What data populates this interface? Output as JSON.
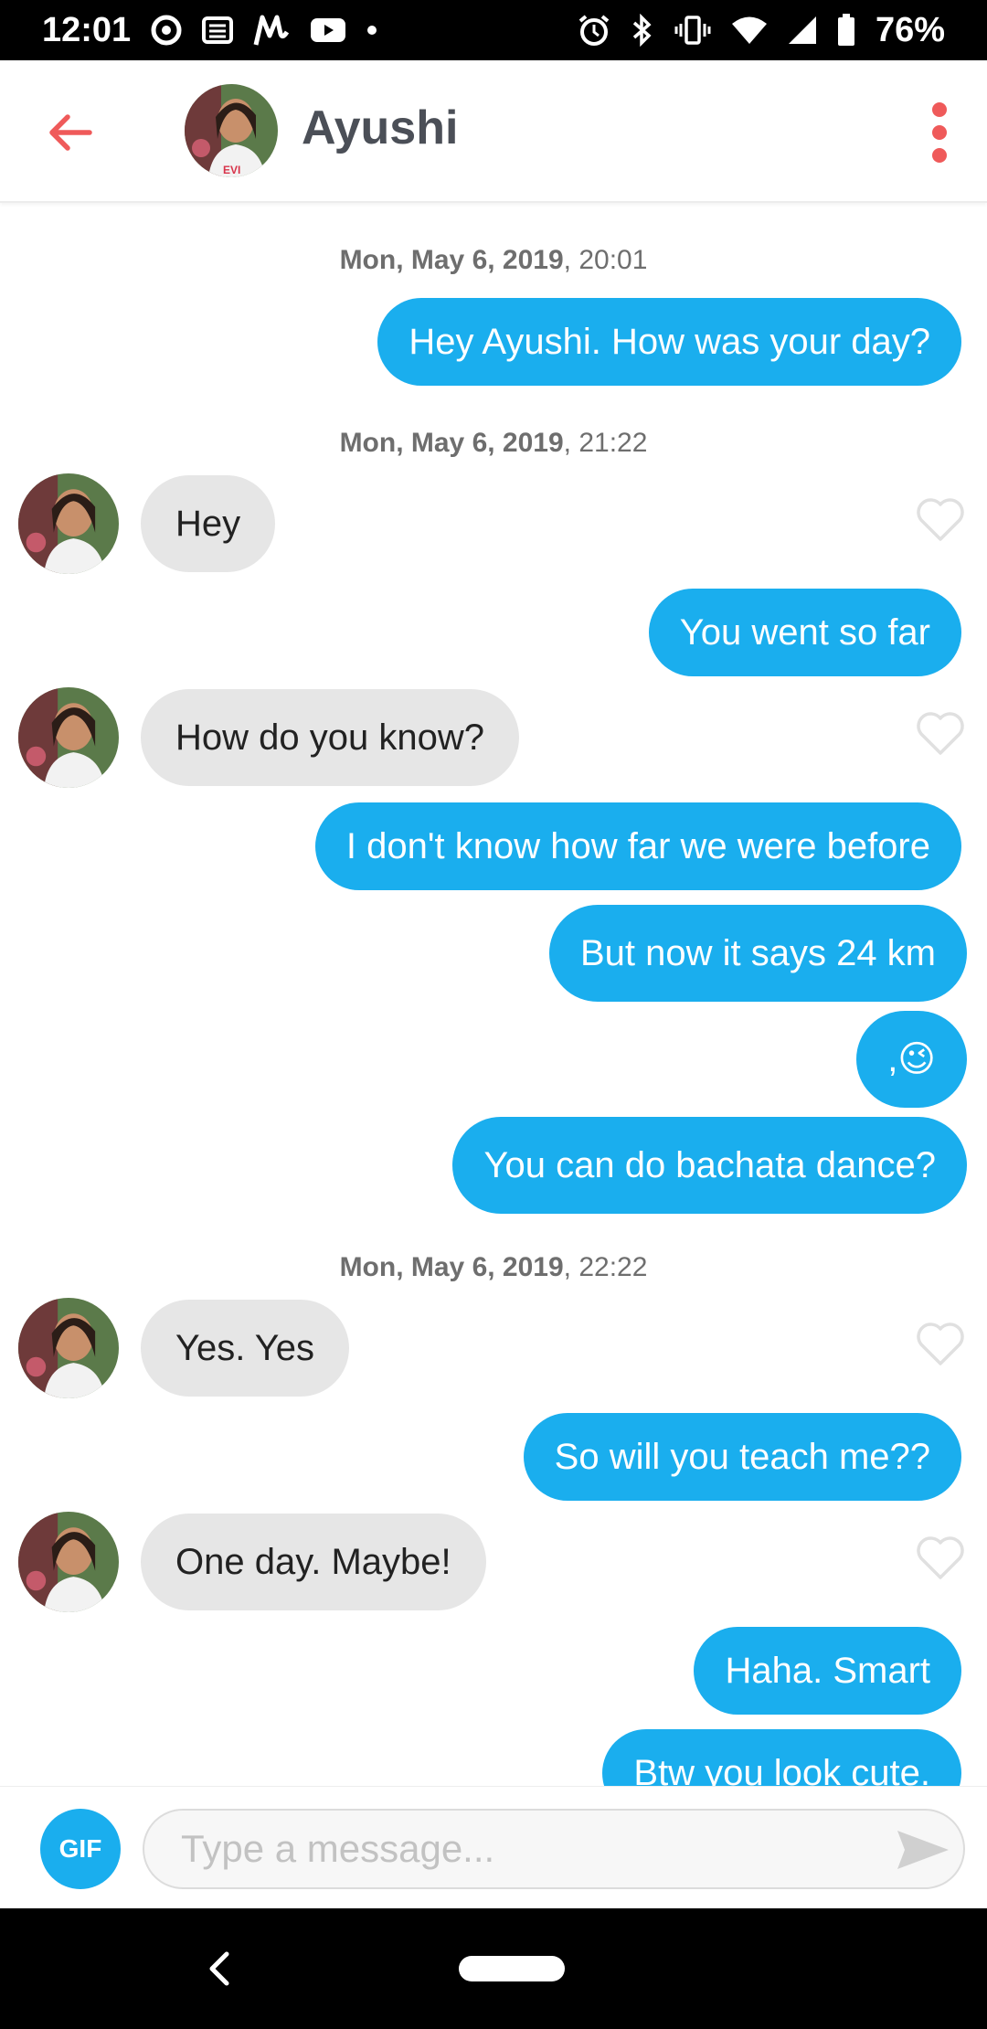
{
  "status_bar": {
    "time": "12:01",
    "battery": "76%",
    "left_icons": [
      "play-circle-icon",
      "news-icon",
      "myntra-icon",
      "youtube-icon",
      "dot-icon"
    ],
    "right_icons": [
      "alarm-icon",
      "bluetooth-icon",
      "vibrate-icon",
      "wifi-icon",
      "signal-icon",
      "battery-icon"
    ]
  },
  "header": {
    "name": "Ayushi"
  },
  "conversation": [
    {
      "type": "timestamp",
      "date": "Mon, May 6, 2019",
      "time": ", 20:01"
    },
    {
      "type": "sent",
      "text": "Hey Ayushi. How was your day?"
    },
    {
      "type": "timestamp",
      "date": "Mon, May 6, 2019",
      "time": ", 21:22"
    },
    {
      "type": "received",
      "text": "Hey"
    },
    {
      "type": "sent",
      "text": "You went so far"
    },
    {
      "type": "received",
      "text": "How do you know?"
    },
    {
      "type": "sent",
      "text": "I don't know how far we were before"
    },
    {
      "type": "sent",
      "text": "But now it says 24 km"
    },
    {
      "type": "sent",
      "text": ",😉"
    },
    {
      "type": "sent",
      "text": "You can do bachata dance?"
    },
    {
      "type": "timestamp",
      "date": "Mon, May 6, 2019",
      "time": ", 22:22"
    },
    {
      "type": "received",
      "text": "Yes. Yes"
    },
    {
      "type": "sent",
      "text": "So will you teach me??"
    },
    {
      "type": "received",
      "text": "One day. Maybe!"
    },
    {
      "type": "sent",
      "text": "Haha. Smart"
    },
    {
      "type": "sent",
      "text": "Btw you look cute."
    }
  ],
  "composer": {
    "gif_label": "GIF",
    "placeholder": "Type a message..."
  },
  "colors": {
    "accent_red": "#ef5a5a",
    "sent_bubble": "#1aaeee",
    "received_bubble": "#e6e6e6"
  }
}
